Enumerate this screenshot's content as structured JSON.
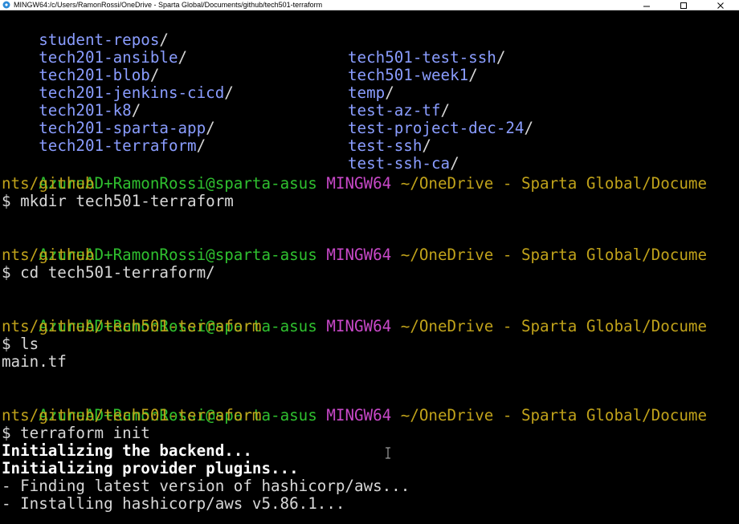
{
  "window": {
    "title": "MINGW64:/c/Users/RamonRossi/OneDrive - Sparta Global/Documents/github/tech501-terraform",
    "minimize_icon": "minimize-icon",
    "maximize_icon": "maximize-icon",
    "close_icon": "close-icon"
  },
  "listing": {
    "left": [
      {
        "name": "student-repos",
        "slash": "/"
      },
      {
        "name": "tech201-ansible",
        "slash": "/"
      },
      {
        "name": "tech201-blob",
        "slash": "/"
      },
      {
        "name": "tech201-jenkins-cicd",
        "slash": "/"
      },
      {
        "name": "tech201-k8",
        "slash": "/"
      },
      {
        "name": "tech201-sparta-app",
        "slash": "/"
      },
      {
        "name": "tech201-terraform",
        "slash": "/"
      }
    ],
    "right": [
      {
        "name": "tech501-test-ssh",
        "slash": "/"
      },
      {
        "name": "tech501-week1",
        "slash": "/"
      },
      {
        "name": "temp",
        "slash": "/"
      },
      {
        "name": "test-az-tf",
        "slash": "/"
      },
      {
        "name": "test-project-dec-24",
        "slash": "/"
      },
      {
        "name": "test-ssh",
        "slash": "/"
      },
      {
        "name": "test-ssh-ca",
        "slash": "/"
      }
    ]
  },
  "prompts": [
    {
      "user": "AzureAD+RamonRossi@sparta-asus",
      "shell": "MINGW64",
      "path1": "~/OneDrive - Sparta Global/Docume",
      "path2": "nts/github",
      "command": "$ mkdir tech501-terraform"
    },
    {
      "user": "AzureAD+RamonRossi@sparta-asus",
      "shell": "MINGW64",
      "path1": "~/OneDrive - Sparta Global/Docume",
      "path2": "nts/github",
      "command": "$ cd tech501-terraform/"
    },
    {
      "user": "AzureAD+RamonRossi@sparta-asus",
      "shell": "MINGW64",
      "path1": "~/OneDrive - Sparta Global/Docume",
      "path2": "nts/github/tech501-terraform",
      "command": "$ ls"
    },
    {
      "user": "AzureAD+RamonRossi@sparta-asus",
      "shell": "MINGW64",
      "path1": "~/OneDrive - Sparta Global/Docume",
      "path2": "nts/github/tech501-terraform",
      "command": "$ terraform init"
    }
  ],
  "ls_output": "main.tf",
  "init_output": {
    "line1": "Initializing the backend...",
    "line2": "Initializing provider plugins...",
    "line3": "- Finding latest version of hashicorp/aws...",
    "line4": "- Installing hashicorp/aws v5.86.1..."
  },
  "colors": {
    "background": "#000000",
    "directory": "#8a9dff",
    "prompt_user": "#2fc02f",
    "prompt_shell": "#c848c8",
    "prompt_path": "#c0a21a",
    "text": "#d8d8d8"
  },
  "icons": {
    "app": "mingw-app-icon",
    "mouse_cursor": "text-cursor-icon"
  }
}
